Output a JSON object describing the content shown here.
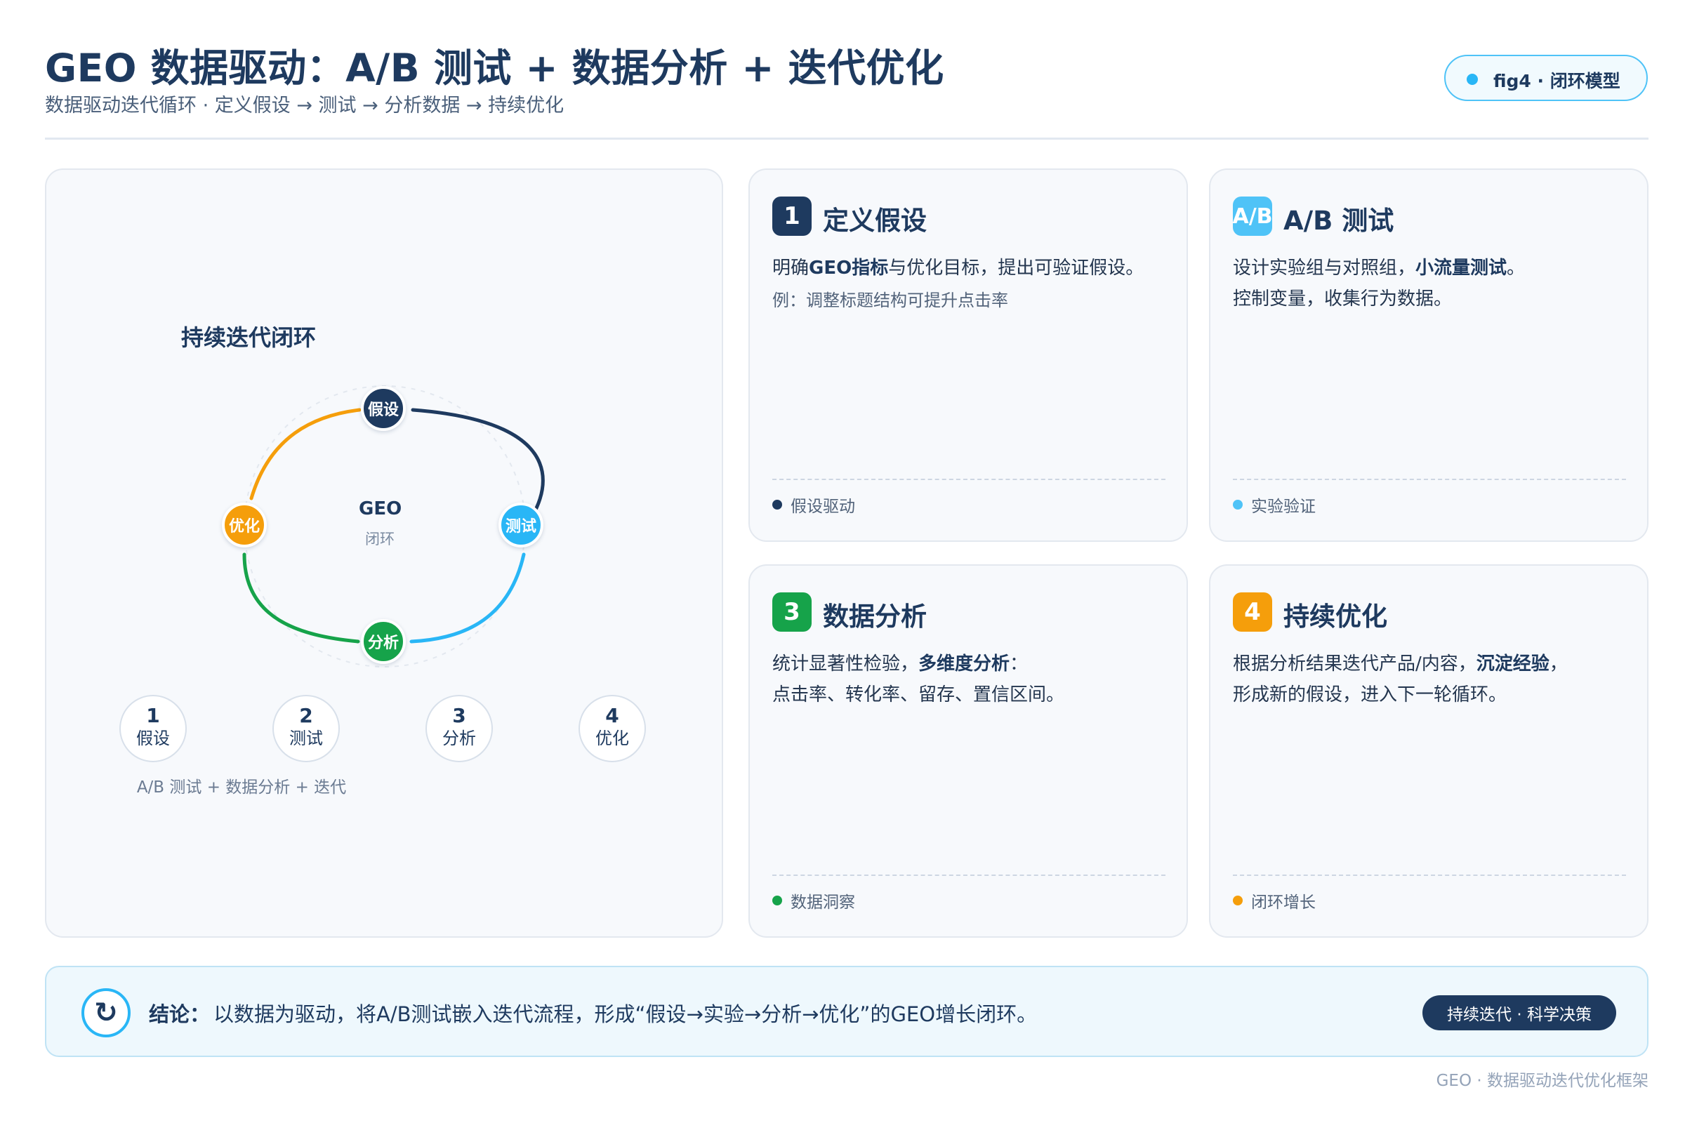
{
  "header": {
    "title": "GEO 数据驱动：A/B 测试 + 数据分析 + 迭代优化",
    "subtitle": "数据驱动迭代循环 · 定义假设 → 测试 → 分析数据 → 持续优化",
    "badge": "fig4 · 闭环模型"
  },
  "diagram": {
    "title": "持续迭代闭环",
    "center_title": "GEO",
    "center_sub": "闭环",
    "nodes": [
      {
        "label": "假设",
        "color": "#1e3a5f"
      },
      {
        "label": "测试",
        "color": "#29b6f6"
      },
      {
        "label": "分析",
        "color": "#16a34a"
      },
      {
        "label": "优化",
        "color": "#f59e0b"
      }
    ],
    "steps": [
      {
        "num": "1",
        "label": "假设"
      },
      {
        "num": "2",
        "label": "测试"
      },
      {
        "num": "3",
        "label": "分析"
      },
      {
        "num": "4",
        "label": "优化"
      }
    ],
    "caption": "A/B 测试 + 数据分析 + 迭代"
  },
  "cards": [
    {
      "num": "1",
      "title": "定义假设",
      "color": "#1e3a5f",
      "desc_pre": "明确",
      "desc_bold": "GEO指标",
      "desc_post": "与优化目标，提出可验证假设。",
      "example": "例：调整标题结构可提升点击率",
      "footer": "假设驱动"
    },
    {
      "num": "A/B",
      "title": "A/B 测试",
      "color": "#4fc3f7",
      "desc_pre": "设计实验组与对照组，",
      "desc_bold": "小流量测试",
      "desc_post": "。",
      "line2": "控制变量，收集行为数据。",
      "footer": "实验验证"
    },
    {
      "num": "3",
      "title": "数据分析",
      "color": "#16a34a",
      "desc_pre": "统计显著性检验，",
      "desc_bold": "多维度分析",
      "desc_post": "：",
      "line2": "点击率、转化率、留存、置信区间。",
      "footer": "数据洞察"
    },
    {
      "num": "4",
      "title": "持续优化",
      "color": "#f59e0b",
      "desc_pre": "根据分析结果迭代产品/内容，",
      "desc_bold": "沉淀经验",
      "desc_post": "，",
      "line2": "形成新的假设，进入下一轮循环。",
      "footer": "闭环增长"
    }
  ],
  "conclusion": {
    "icon": "refresh-icon",
    "label": "结论：",
    "text": "以数据为驱动，将A/B测试嵌入迭代流程，形成“假设→实验→分析→优化”的GEO增长闭环。",
    "tag": "持续迭代 · 科学决策"
  },
  "footer": "GEO · 数据驱动迭代优化框架"
}
